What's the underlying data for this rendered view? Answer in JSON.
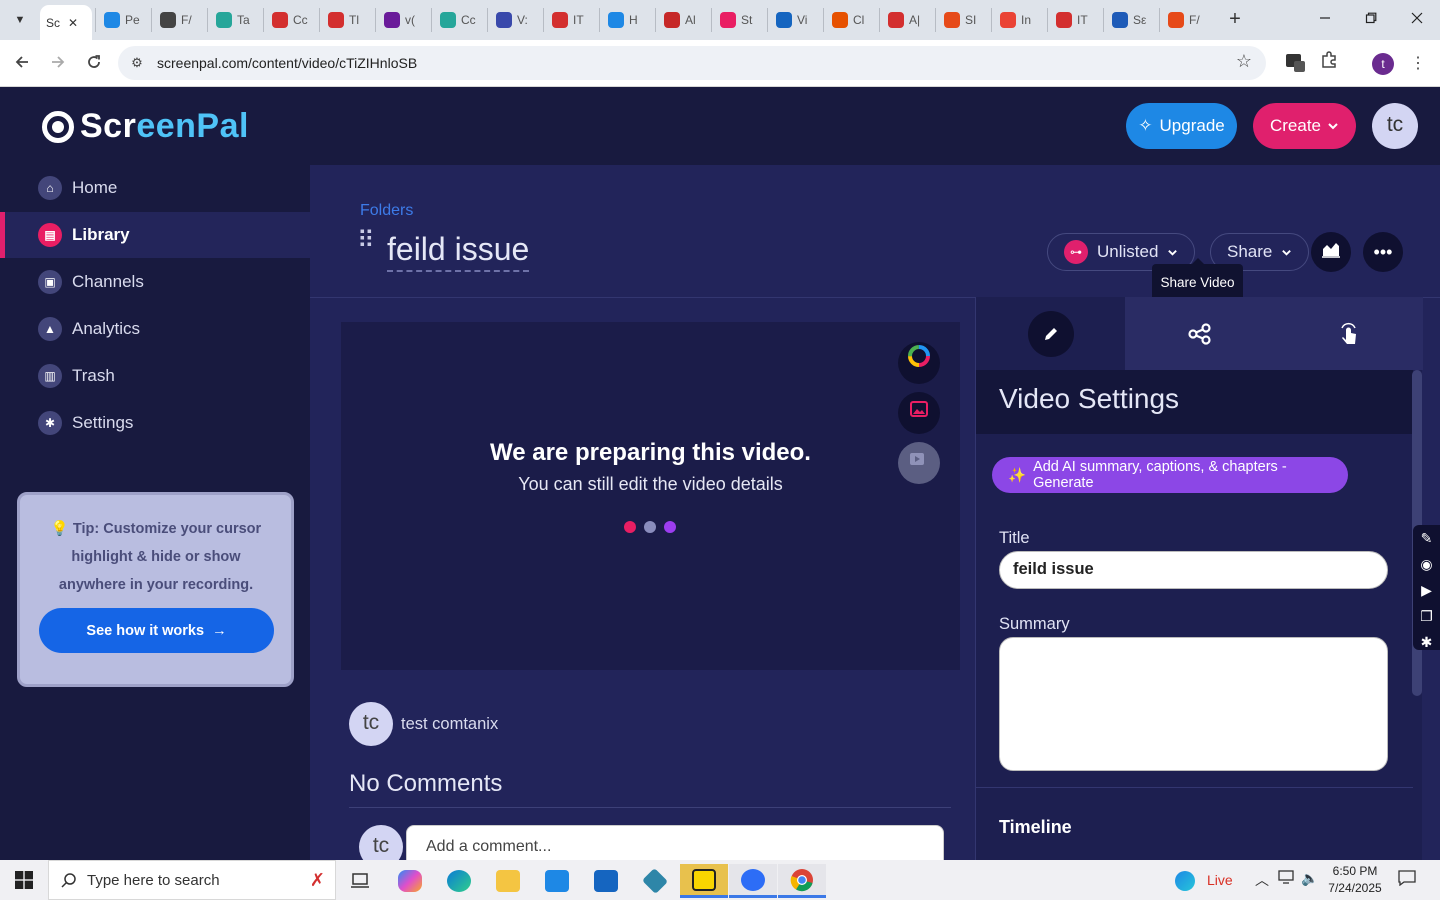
{
  "browser": {
    "active_tab": {
      "title": "Sc",
      "close": "✕"
    },
    "tabs": [
      {
        "label": "Pe",
        "color": "#1e88e5"
      },
      {
        "label": "F/",
        "color": "#444444"
      },
      {
        "label": "Ta",
        "color": "#26a69a"
      },
      {
        "label": "Cc",
        "color": "#d32f2f"
      },
      {
        "label": "Tl",
        "color": "#d32f2f"
      },
      {
        "label": "v(",
        "color": "#6a1b9a"
      },
      {
        "label": "Cc",
        "color": "#26a69a"
      },
      {
        "label": "V:",
        "color": "#3949ab"
      },
      {
        "label": "IT",
        "color": "#d32f2f"
      },
      {
        "label": "H",
        "color": "#1e88e5"
      },
      {
        "label": "Al",
        "color": "#c62828"
      },
      {
        "label": "St",
        "color": "#e91e63"
      },
      {
        "label": "Vi",
        "color": "#1565c0"
      },
      {
        "label": "Cl",
        "color": "#e65100"
      },
      {
        "label": "A|",
        "color": "#d32f2f"
      },
      {
        "label": "SI",
        "color": "#e64a19"
      },
      {
        "label": "In",
        "color": "#ea4335"
      },
      {
        "label": "IT",
        "color": "#d32f2f"
      },
      {
        "label": "Sε",
        "color": "#1e5bb8"
      },
      {
        "label": "F/",
        "color": "#e64a19"
      }
    ],
    "new_tab": "+",
    "url": "screenpal.com/content/video/cTiZIHnloSB",
    "profile_initial": "t"
  },
  "app": {
    "logo": {
      "pre": "Scr",
      "post": "eenPal"
    },
    "nav": [
      {
        "label": "Home",
        "icon": "home-icon",
        "glyph": "⌂"
      },
      {
        "label": "Library",
        "icon": "library-icon",
        "glyph": "▤"
      },
      {
        "label": "Channels",
        "icon": "channels-icon",
        "glyph": "▣"
      },
      {
        "label": "Analytics",
        "icon": "analytics-icon",
        "glyph": "▲"
      },
      {
        "label": "Trash",
        "icon": "trash-icon",
        "glyph": "▥"
      },
      {
        "label": "Settings",
        "icon": "settings-icon",
        "glyph": "✱"
      }
    ],
    "tip": {
      "icon": "💡",
      "text": "Tip: Customize your cursor highlight & hide or show anywhere in your recording.",
      "button": "See how it works",
      "arrow": "→"
    },
    "topbar": {
      "upgrade": "Upgrade",
      "create": "Create",
      "avatar": "tc"
    }
  },
  "video": {
    "breadcrumb": "Folders",
    "title": "feild issue",
    "visibility": "Unlisted",
    "share": "Share",
    "tooltip": "Share Video",
    "preparing_title": "We are preparing this video.",
    "preparing_sub": "You can still edit the video details",
    "loading_dot_colors": [
      "#e91e63",
      "#8a8dbd",
      "#9c3df0"
    ],
    "owner_avatar": "tc",
    "owner_name": "test comtanix",
    "comments_heading": "No Comments",
    "comment_avatar": "tc",
    "comment_placeholder": "Add a comment..."
  },
  "settings": {
    "heading": "Video Settings",
    "ai_button": "Add AI summary, captions, & chapters - Generate",
    "title_label": "Title",
    "title_value": "feild issue",
    "summary_label": "Summary",
    "summary_value": "",
    "timeline_label": "Timeline"
  },
  "taskbar": {
    "search_placeholder": "Type here to search",
    "live_label": "Live",
    "time": "6:50 PM",
    "date": "7/24/2025"
  },
  "colors": {
    "accent_pink": "#e0206d",
    "accent_blue": "#1e88e5",
    "purple_button": "#8c47e6",
    "sidebar_bg": "#181a3f",
    "main_bg": "#22245a"
  }
}
